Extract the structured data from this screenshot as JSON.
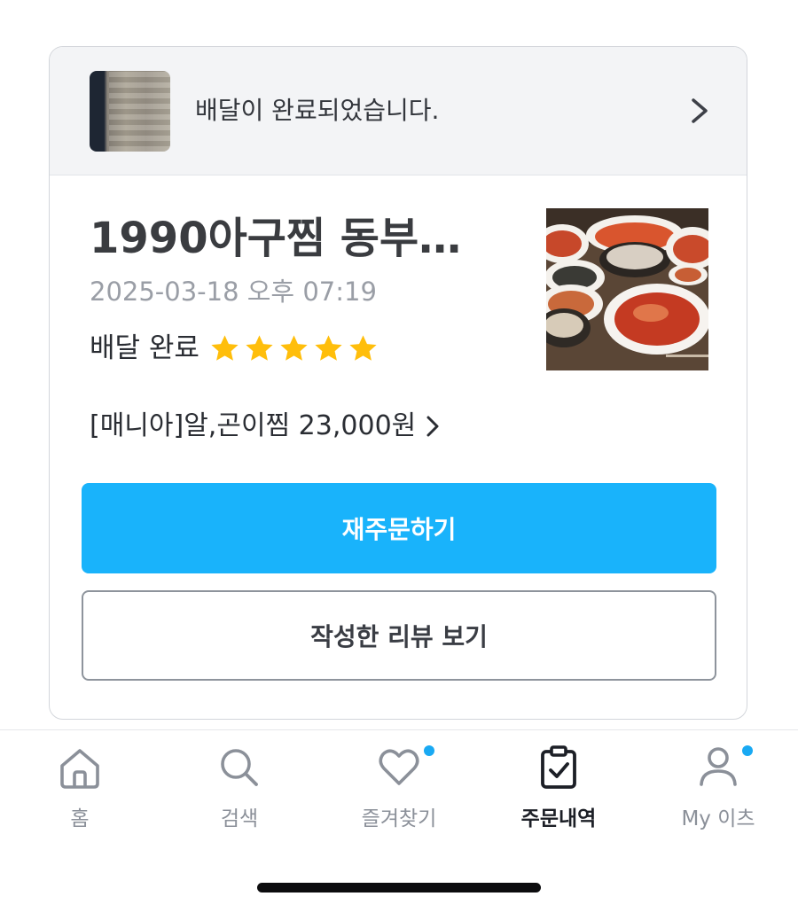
{
  "order": {
    "status_message": "배달이 완료되었습니다.",
    "store_name": "1990아구찜 동부…",
    "order_date": "2025-03-18 오후 07:19",
    "delivery_status": "배달 완료",
    "rating": 5,
    "menu_summary": "[매니아]알,곤이찜 23,000원",
    "reorder_label": "재주문하기",
    "view_review_label": "작성한 리뷰 보기"
  },
  "tab_bar": {
    "items": [
      {
        "label": "홈",
        "icon": "home-icon"
      },
      {
        "label": "검색",
        "icon": "search-icon"
      },
      {
        "label": "즐겨찾기",
        "icon": "heart-icon",
        "badge": true
      },
      {
        "label": "주문내역",
        "icon": "clipboard-check-icon",
        "active": true
      },
      {
        "label": "My 이츠",
        "icon": "person-icon",
        "badge": true
      }
    ]
  },
  "colors": {
    "accent": "#19b3fb",
    "star": "#ffbe0b",
    "badge": "#19a9f3"
  }
}
